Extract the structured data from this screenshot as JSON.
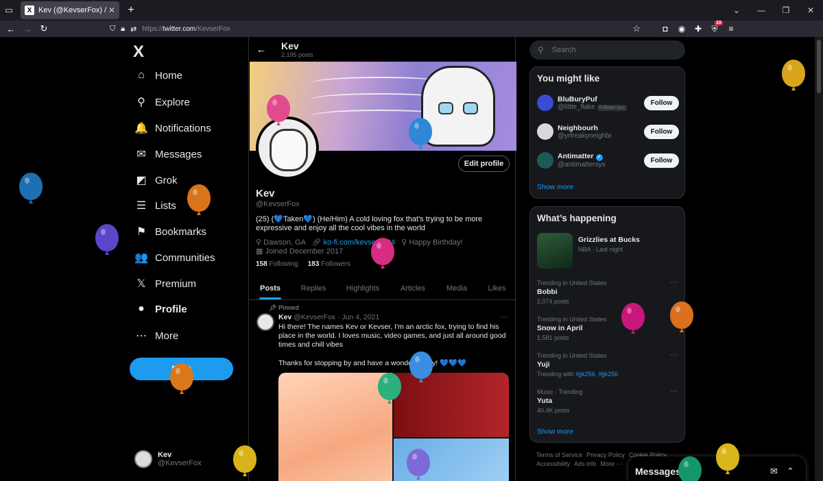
{
  "browser": {
    "tab_title": "Kev (@KevserFox) / X",
    "tab_favicon": "X",
    "new_tab_symbol": "+",
    "url_prefix": "https://",
    "url_host": "twitter.com",
    "url_path": "/KevserFox",
    "extension_badge": "10"
  },
  "nav": {
    "logo": "X",
    "items": [
      {
        "label": "Home",
        "icon": "home-icon",
        "glyph": "⌂"
      },
      {
        "label": "Explore",
        "icon": "search-icon",
        "glyph": "⚲"
      },
      {
        "label": "Notifications",
        "icon": "bell-icon",
        "glyph": "🔔"
      },
      {
        "label": "Messages",
        "icon": "mail-icon",
        "glyph": "✉"
      },
      {
        "label": "Grok",
        "icon": "grok-icon",
        "glyph": "◩"
      },
      {
        "label": "Lists",
        "icon": "list-icon",
        "glyph": "☰"
      },
      {
        "label": "Bookmarks",
        "icon": "bookmark-icon",
        "glyph": "⚑"
      },
      {
        "label": "Communities",
        "icon": "people-icon",
        "glyph": "👥"
      },
      {
        "label": "Premium",
        "icon": "x-premium-icon",
        "glyph": "𝕏"
      },
      {
        "label": "Profile",
        "icon": "person-icon",
        "glyph": "●"
      },
      {
        "label": "More",
        "icon": "more-circle-icon",
        "glyph": "⋯"
      }
    ],
    "post_label": "Post",
    "account_name": "Kev",
    "account_handle": "@KevserFox",
    "account_more": "···"
  },
  "profile": {
    "header_name": "Kev",
    "header_count": "2,195 posts",
    "edit_label": "Edit profile",
    "name": "Kev",
    "handle": "@KevserFox",
    "bio": "(25) (💙Taken💙) (He/Him) A cold loving fox that's trying to be more expressive and enjoy all the cool vibes in the world",
    "location": "Dawson, GA",
    "link": "ko-fi.com/kevser0334",
    "birthday": "Happy Birthday!",
    "joined": "Joined December 2017",
    "following_count": "158",
    "following_label": "Following",
    "followers_count": "183",
    "followers_label": "Followers",
    "tabs": [
      "Posts",
      "Replies",
      "Highlights",
      "Articles",
      "Media",
      "Likes"
    ]
  },
  "tweet": {
    "pinned_label": "Pinned",
    "name": "Kev",
    "handle": "@KevserFox",
    "date": "· Jun 4, 2021",
    "more": "···",
    "text": "Hi there! The names Kev or Kevser, I'm an arctic fox, trying to find his place in the world. I loves music, video games, and just all around good times and chill vibes",
    "text2": "Thanks for stopping by and have a wonderful day! 💙💙💙"
  },
  "right": {
    "search_placeholder": "Search",
    "wtf_title": "You might like",
    "suggestions": [
      {
        "name": "BluBuryPuf",
        "handle": "@little_flake",
        "note": "Follows you",
        "verified": false,
        "btn": "Follow",
        "color": "#3a4bd6"
      },
      {
        "name": "Neighbourh",
        "handle": "@yrfreakyneighbr",
        "note": "",
        "verified": false,
        "btn": "Follow",
        "color": "#d9d9d9"
      },
      {
        "name": "Antimatter",
        "handle": "@antimattersys",
        "note": "",
        "verified": true,
        "btn": "Follow",
        "color": "#1c5b55"
      }
    ],
    "wtf_more": "Show more",
    "happening_title": "What’s happening",
    "event_name": "Grizzlies at Bucks",
    "event_meta": "NBA · Last night",
    "trends": [
      {
        "context": "Trending in United States",
        "title": "Bobbi",
        "posts": "2,074 posts",
        "tags": ""
      },
      {
        "context": "Trending in United States",
        "title": "Snow in April",
        "posts": "1,581 posts",
        "tags": ""
      },
      {
        "context": "Trending in United States",
        "title": "Yuji",
        "posts": "Trending with",
        "tags": "#jjk256, #jjk256"
      },
      {
        "context": "Music · Trending",
        "title": "Yuta",
        "posts": "40.4K posts",
        "tags": ""
      }
    ],
    "trend_more": "···",
    "happening_more": "Show more",
    "footer": [
      "Terms of Service",
      "Privacy Policy",
      "Cookie Policy",
      "Accessibility",
      "Ads info",
      "More ···"
    ],
    "messages_title": "Messages"
  },
  "balloons": [
    {
      "color": "#1e6fb4"
    },
    {
      "color": "#d8741c"
    },
    {
      "color": "#5b45c9"
    },
    {
      "color": "#d8a51c"
    },
    {
      "color": "#e24a8f"
    },
    {
      "color": "#d62c82"
    },
    {
      "color": "#2f88d6"
    },
    {
      "color": "#2db07e"
    },
    {
      "color": "#d9711f"
    },
    {
      "color": "#d9b21c"
    },
    {
      "color": "#7d6ad8"
    },
    {
      "color": "#c9167a"
    },
    {
      "color": "#d9781c"
    },
    {
      "color": "#d9b61c"
    },
    {
      "color": "#139669"
    },
    {
      "color": "#3a8de0"
    }
  ]
}
